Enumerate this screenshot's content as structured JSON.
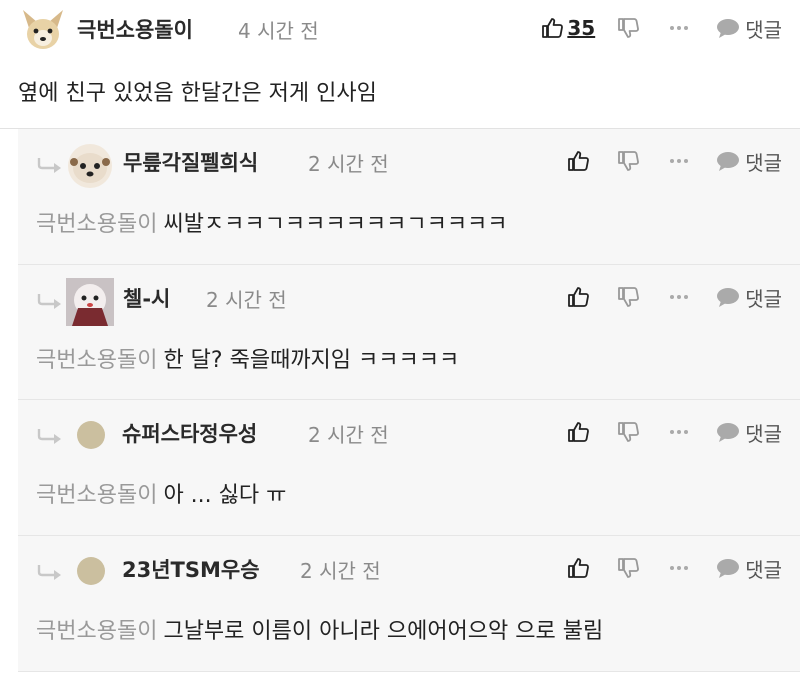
{
  "comments": [
    {
      "nickname": "극번소용돌이",
      "time": "4 시간 전",
      "likes": "35",
      "text": "옆에 친구 있었음 한달간은 저게 인사임",
      "reply_label": "댓글"
    }
  ],
  "replies": [
    {
      "nickname": "무릎각질펠희식",
      "time": "2 시간 전",
      "mention": "극번소용돌이",
      "text": "씨발ㅈㅋㅋㄱㅋㅋㅋㅋㅋㅋㄱㅋㅋㅋㅋ",
      "reply_label": "댓글"
    },
    {
      "nickname": "첼-시",
      "time": "2 시간 전",
      "mention": "극번소용돌이",
      "text": "한 달? 죽을때까지임 ㅋㅋㅋㅋㅋ",
      "reply_label": "댓글"
    },
    {
      "nickname": "슈퍼스타정우성",
      "time": "2 시간 전",
      "mention": "극번소용돌이",
      "text": "아 ... 싫다 ㅠ",
      "reply_label": "댓글"
    },
    {
      "nickname": "23년TSM우승",
      "time": "2 시간 전",
      "mention": "극번소용돌이",
      "text": "그날부로 이름이 아니라 으에어어으악 으로 불림",
      "reply_label": "댓글"
    }
  ],
  "icons": {
    "like": "thumbs-up-icon",
    "dislike": "thumbs-down-icon",
    "more": "more-dots-icon",
    "reply": "speech-bubble-icon",
    "reply_arrow": "reply-arrow-icon"
  },
  "colors": {
    "reply_background": "#f7f7f7",
    "mention": "#9a9a9a",
    "time": "#8a8a8a"
  }
}
